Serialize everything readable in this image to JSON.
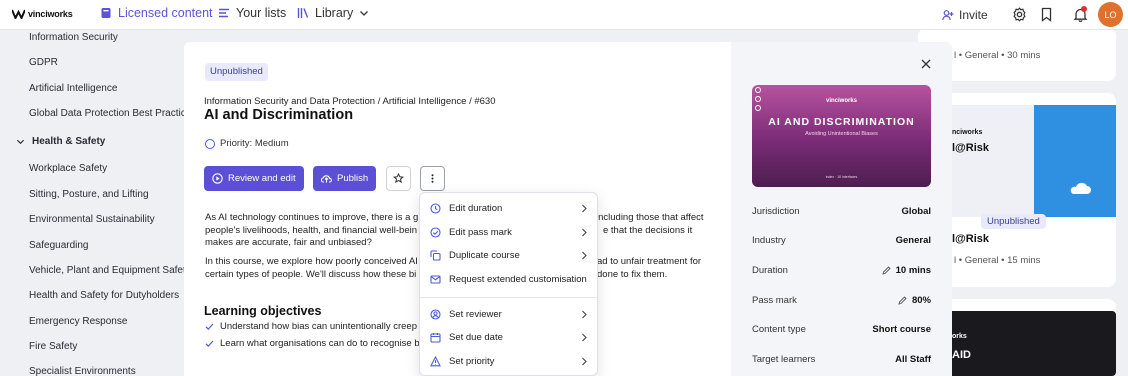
{
  "header": {
    "brand": "vinciworks",
    "nav": [
      {
        "label": "Licensed content",
        "icon": "book-icon",
        "active": true
      },
      {
        "label": "Your lists",
        "icon": "list-icon"
      },
      {
        "label": "Library",
        "icon": "library-icon"
      }
    ],
    "invite_label": "Invite",
    "avatar_initials": "LO",
    "accent_color": "#5b4fd6"
  },
  "sidebar": {
    "items": [
      "Information Security",
      "GDPR",
      "Artificial Intelligence",
      "Global Data Protection Best Practice",
      "Health & Safety",
      "Workplace Safety",
      "Sitting, Posture, and Lifting",
      "Environmental Sustainability",
      "Safeguarding",
      "Vehicle, Plant and Equipment Safety",
      "Health and Safety for Dutyholders",
      "Emergency Response",
      "Fire Safety",
      "Specialist Environments"
    ]
  },
  "background_cards": {
    "top_right_meta": "l • General • 30 mins",
    "card_brand": "nciworks",
    "card_title": "l@Risk",
    "card_badge": "Unpublished",
    "card_name": "l@Risk",
    "card_meta": "l • General • 15 mins",
    "bottom_brand": "orks",
    "bottom_title": "AID"
  },
  "modal": {
    "status_badge": "Unpublished",
    "breadcrumb": "Information Security and Data Protection / Artificial Intelligence / #630",
    "title": "AI and Discrimination",
    "priority": "Priority: Medium",
    "review_button": "Review and edit",
    "publish_button": "Publish",
    "description_1": "As AI technology continues to improve, there is a g... including those that affect people's livelihoods, health, and financial well-bein... e that the decisions it makes are accurate, fair and unbiased?",
    "description_1a": "As AI technology continues to improve, there is a g",
    "description_1b": "including those that affect",
    "description_1c": "people's livelihoods, health, and financial well-bein",
    "description_1d": "e that the decisions it",
    "description_1e": "makes are accurate, fair and unbiased?",
    "description_2a": "In this course, we explore how poorly conceived AI",
    "description_2b": "ad to unfair treatment for",
    "description_2c": "certain types of people. We'll discuss how these bi",
    "description_2d": "done to fix them.",
    "objectives_title": "Learning objectives",
    "objectives": [
      "Understand how bias can unintentionally creep i",
      "Learn what organisations can do to recognise bi"
    ]
  },
  "thumbnail": {
    "brand": "vinciworks",
    "title": "AI AND DISCRIMINATION",
    "subtitle": "Avoiding Unintentional Biases",
    "footer": "index · 10 interfaces"
  },
  "details": [
    {
      "label": "Jurisdiction",
      "value": "Global",
      "editable": false
    },
    {
      "label": "Industry",
      "value": "General",
      "editable": false
    },
    {
      "label": "Duration",
      "value": "10 mins",
      "editable": true
    },
    {
      "label": "Pass mark",
      "value": "80%",
      "editable": true
    },
    {
      "label": "Content type",
      "value": "Short course",
      "editable": false
    },
    {
      "label": "Target learners",
      "value": "All Staff",
      "editable": false
    }
  ],
  "menu": {
    "items": [
      {
        "label": "Edit duration",
        "icon": "clock-icon",
        "submenu": true
      },
      {
        "label": "Edit pass mark",
        "icon": "check-circle-icon",
        "submenu": true
      },
      {
        "label": "Duplicate course",
        "icon": "copy-icon",
        "submenu": true
      },
      {
        "label": "Request extended customisation",
        "icon": "mail-icon",
        "submenu": false
      },
      {
        "label": "Set reviewer",
        "icon": "user-circle-icon",
        "submenu": true
      },
      {
        "label": "Set due date",
        "icon": "calendar-icon",
        "submenu": true
      },
      {
        "label": "Set priority",
        "icon": "warning-icon",
        "submenu": true
      }
    ]
  }
}
